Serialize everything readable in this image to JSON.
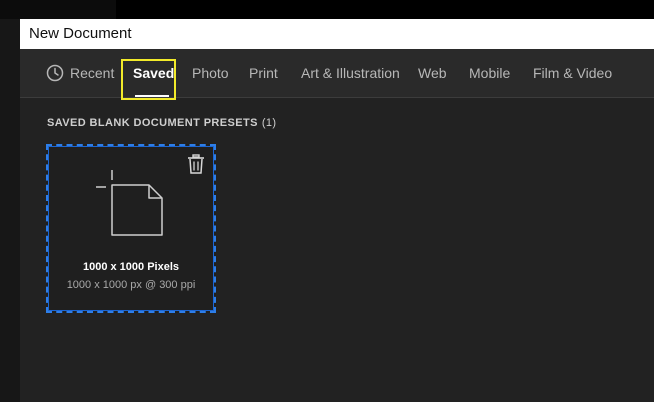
{
  "dialog": {
    "title": "New Document"
  },
  "tabs": [
    {
      "label": "Recent",
      "icon": "clock-icon"
    },
    {
      "label": "Saved",
      "active": true
    },
    {
      "label": "Photo"
    },
    {
      "label": "Print"
    },
    {
      "label": "Art & Illustration"
    },
    {
      "label": "Web"
    },
    {
      "label": "Mobile"
    },
    {
      "label": "Film & Video"
    }
  ],
  "section": {
    "label": "SAVED BLANK DOCUMENT PRESETS",
    "count": "(1)"
  },
  "presets": [
    {
      "name": "1000 x 1000 Pixels",
      "details": "1000 x 1000 px @ 300 ppi",
      "selected": true,
      "icon": "blank-document-icon"
    }
  ],
  "colors": {
    "accent": "#2d7ee8",
    "highlight": "#f2ea2a",
    "panel": "#222222",
    "tabbar": "#2a2a2a"
  }
}
